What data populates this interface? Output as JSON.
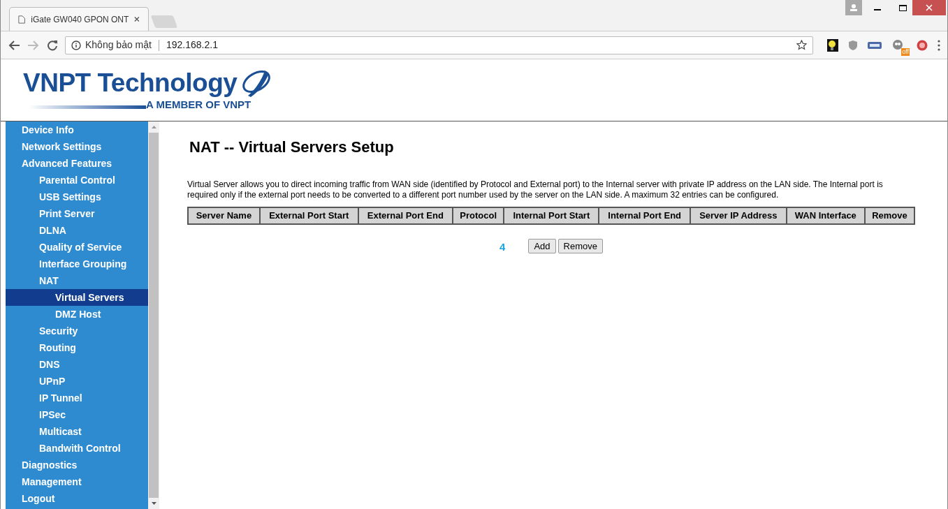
{
  "browser": {
    "tab_title": "iGate GW040 GPON ONT",
    "security_label": "Không bảo mật",
    "url": "192.168.2.1",
    "extension_badge": "off"
  },
  "header": {
    "logo_text": "VNPT Technology",
    "tagline": "A MEMBER OF VNPT"
  },
  "sidebar": {
    "items": [
      {
        "label": "Device Info",
        "selected": false
      },
      {
        "label": "Network Settings",
        "selected": false
      },
      {
        "label": "Advanced Features",
        "selected": false,
        "children": [
          {
            "label": "Parental Control",
            "selected": false
          },
          {
            "label": "USB Settings",
            "selected": false
          },
          {
            "label": "Print Server",
            "selected": false
          },
          {
            "label": "DLNA",
            "selected": false
          },
          {
            "label": "Quality of Service",
            "selected": false
          },
          {
            "label": "Interface Grouping",
            "selected": false
          },
          {
            "label": "NAT",
            "selected": false,
            "children": [
              {
                "label": "Virtual Servers",
                "selected": true
              },
              {
                "label": "DMZ Host",
                "selected": false
              }
            ]
          },
          {
            "label": "Security",
            "selected": false
          },
          {
            "label": "Routing",
            "selected": false
          },
          {
            "label": "DNS",
            "selected": false
          },
          {
            "label": "UPnP",
            "selected": false
          },
          {
            "label": "IP Tunnel",
            "selected": false
          },
          {
            "label": "IPSec",
            "selected": false
          },
          {
            "label": "Multicast",
            "selected": false
          },
          {
            "label": "Bandwith Control",
            "selected": false
          }
        ]
      },
      {
        "label": "Diagnostics",
        "selected": false
      },
      {
        "label": "Management",
        "selected": false
      },
      {
        "label": "Logout",
        "selected": false
      }
    ]
  },
  "page": {
    "title": "NAT -- Virtual Servers Setup",
    "description": "Virtual Server allows you to direct incoming traffic from WAN side (identified by Protocol and External port) to the Internal server with private IP address on the LAN side. The Internal port is required only if the external port needs to be converted to a different port number used by the server on the LAN side. A maximum 32 entries can be configured.",
    "table": {
      "columns": [
        "Server Name",
        "External Port Start",
        "External Port End",
        "Protocol",
        "Internal Port Start",
        "Internal Port End",
        "Server IP Address",
        "WAN Interface",
        "Remove"
      ]
    },
    "step_marker": "4",
    "buttons": [
      "Add",
      "Remove"
    ]
  }
}
